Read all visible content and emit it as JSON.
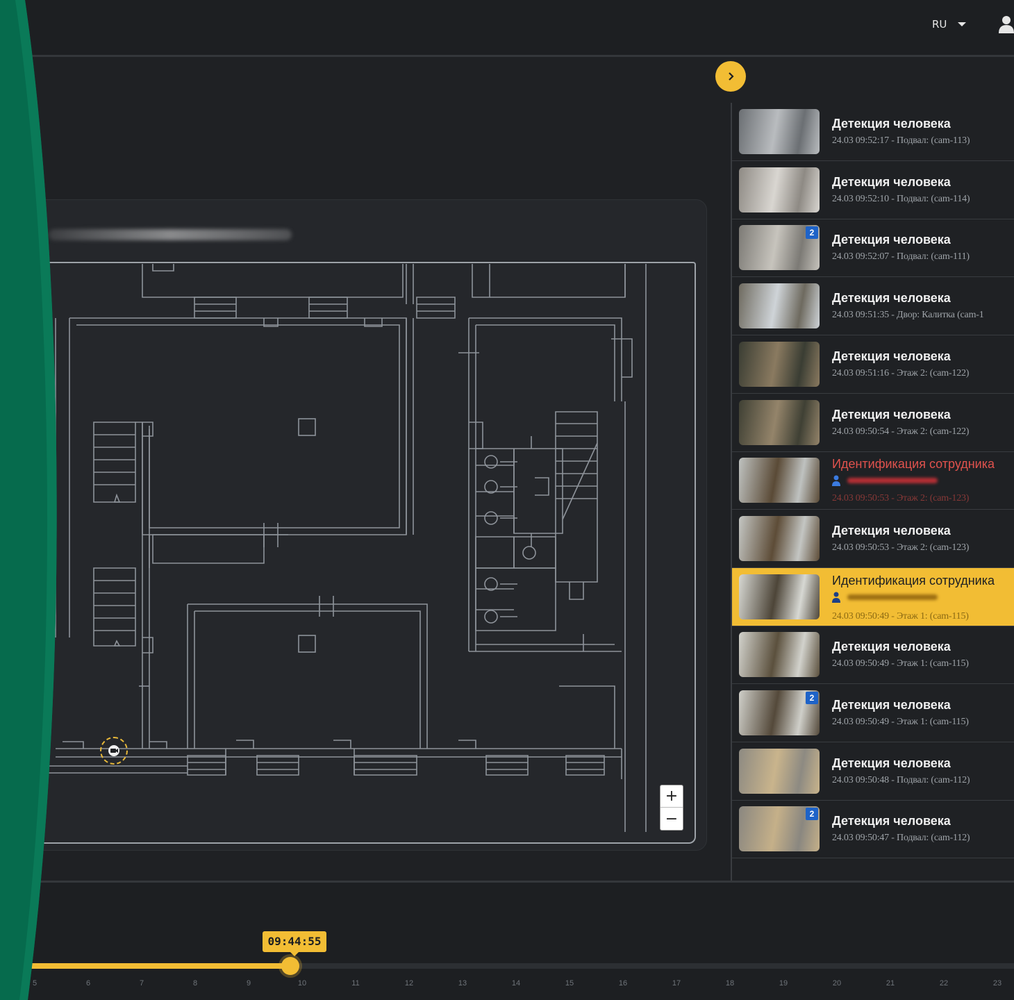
{
  "header": {
    "language": "RU"
  },
  "events": [
    {
      "title": "Детекция человека",
      "subtitle": "24.03 09:52:17 - Подвал: (cam-113)",
      "type": "detect",
      "badge": null,
      "thumb": [
        "#6b6f73",
        "#b9bcbf"
      ]
    },
    {
      "title": "Детекция человека",
      "subtitle": "24.03 09:52:10 - Подвал: (cam-114)",
      "type": "detect",
      "badge": null,
      "thumb": [
        "#8e8a84",
        "#d9d6d1"
      ]
    },
    {
      "title": "Детекция человека",
      "subtitle": "24.03 09:52:07 - Подвал: (cam-111)",
      "type": "detect",
      "badge": "2",
      "thumb": [
        "#7c7a75",
        "#c7c4bd"
      ]
    },
    {
      "title": "Детекция человека",
      "subtitle": "24.03 09:51:35 - Двор: Калитка (cam-1",
      "type": "detect",
      "badge": null,
      "thumb": [
        "#6e6a5f",
        "#cfd4d8"
      ]
    },
    {
      "title": "Детекция человека",
      "subtitle": "24.03 09:51:16 - Этаж 2: (cam-122)",
      "type": "detect",
      "badge": null,
      "thumb": [
        "#3a3d33",
        "#8a7a60"
      ]
    },
    {
      "title": "Детекция человека",
      "subtitle": "24.03 09:50:54 - Этаж 2: (cam-122)",
      "type": "detect",
      "badge": null,
      "thumb": [
        "#3f4034",
        "#94846a"
      ]
    },
    {
      "title": "Идентификация сотрудника",
      "subtitle": "24.03 09:50:53 - Этаж 2: (cam-123)",
      "type": "alert",
      "badge": null,
      "thumb": [
        "#bfc2c0",
        "#5a4a36"
      ]
    },
    {
      "title": "Детекция человека",
      "subtitle": "24.03 09:50:53 - Этаж 2: (cam-123)",
      "type": "detect",
      "badge": null,
      "thumb": [
        "#c4c6c3",
        "#5d4c37"
      ]
    },
    {
      "title": "Идентификация сотрудника",
      "subtitle": "24.03 09:50:49 - Этаж 1: (cam-115)",
      "type": "selected",
      "badge": null,
      "thumb": [
        "#d7d8d3",
        "#4d4538"
      ]
    },
    {
      "title": "Детекция человека",
      "subtitle": "24.03 09:50:49 - Этаж 1: (cam-115)",
      "type": "detect",
      "badge": null,
      "thumb": [
        "#d2d2cc",
        "#5b503d"
      ]
    },
    {
      "title": "Детекция человека",
      "subtitle": "24.03 09:50:49 - Этаж 1: (cam-115)",
      "type": "detect",
      "badge": "2",
      "thumb": [
        "#cfcfc9",
        "#54493a"
      ]
    },
    {
      "title": "Детекция человека",
      "subtitle": "24.03 09:50:48 - Подвал: (cam-112)",
      "type": "detect",
      "badge": null,
      "thumb": [
        "#8d8a82",
        "#c9b48c"
      ]
    },
    {
      "title": "Детекция человека",
      "subtitle": "24.03 09:50:47 - Подвал: (cam-112)",
      "type": "detect",
      "badge": "2",
      "thumb": [
        "#8a8780",
        "#c5b089"
      ]
    }
  ],
  "timeline": {
    "current_time": "09:44:55",
    "ticks": [
      "5",
      "6",
      "7",
      "8",
      "9",
      "10",
      "11",
      "12",
      "13",
      "14",
      "15",
      "16",
      "17",
      "18",
      "19",
      "20",
      "21",
      "22",
      "23"
    ],
    "progress": 0.286
  },
  "colors": {
    "accent": "#f2bd34",
    "alert": "#e0524d",
    "badge": "#1e63c8",
    "background": "#1f2124",
    "wave": "#066b4d"
  },
  "icons": {
    "toggle": "chevron-right-icon",
    "user": "user-icon",
    "camera": "camera-icon",
    "person": "person-icon"
  }
}
